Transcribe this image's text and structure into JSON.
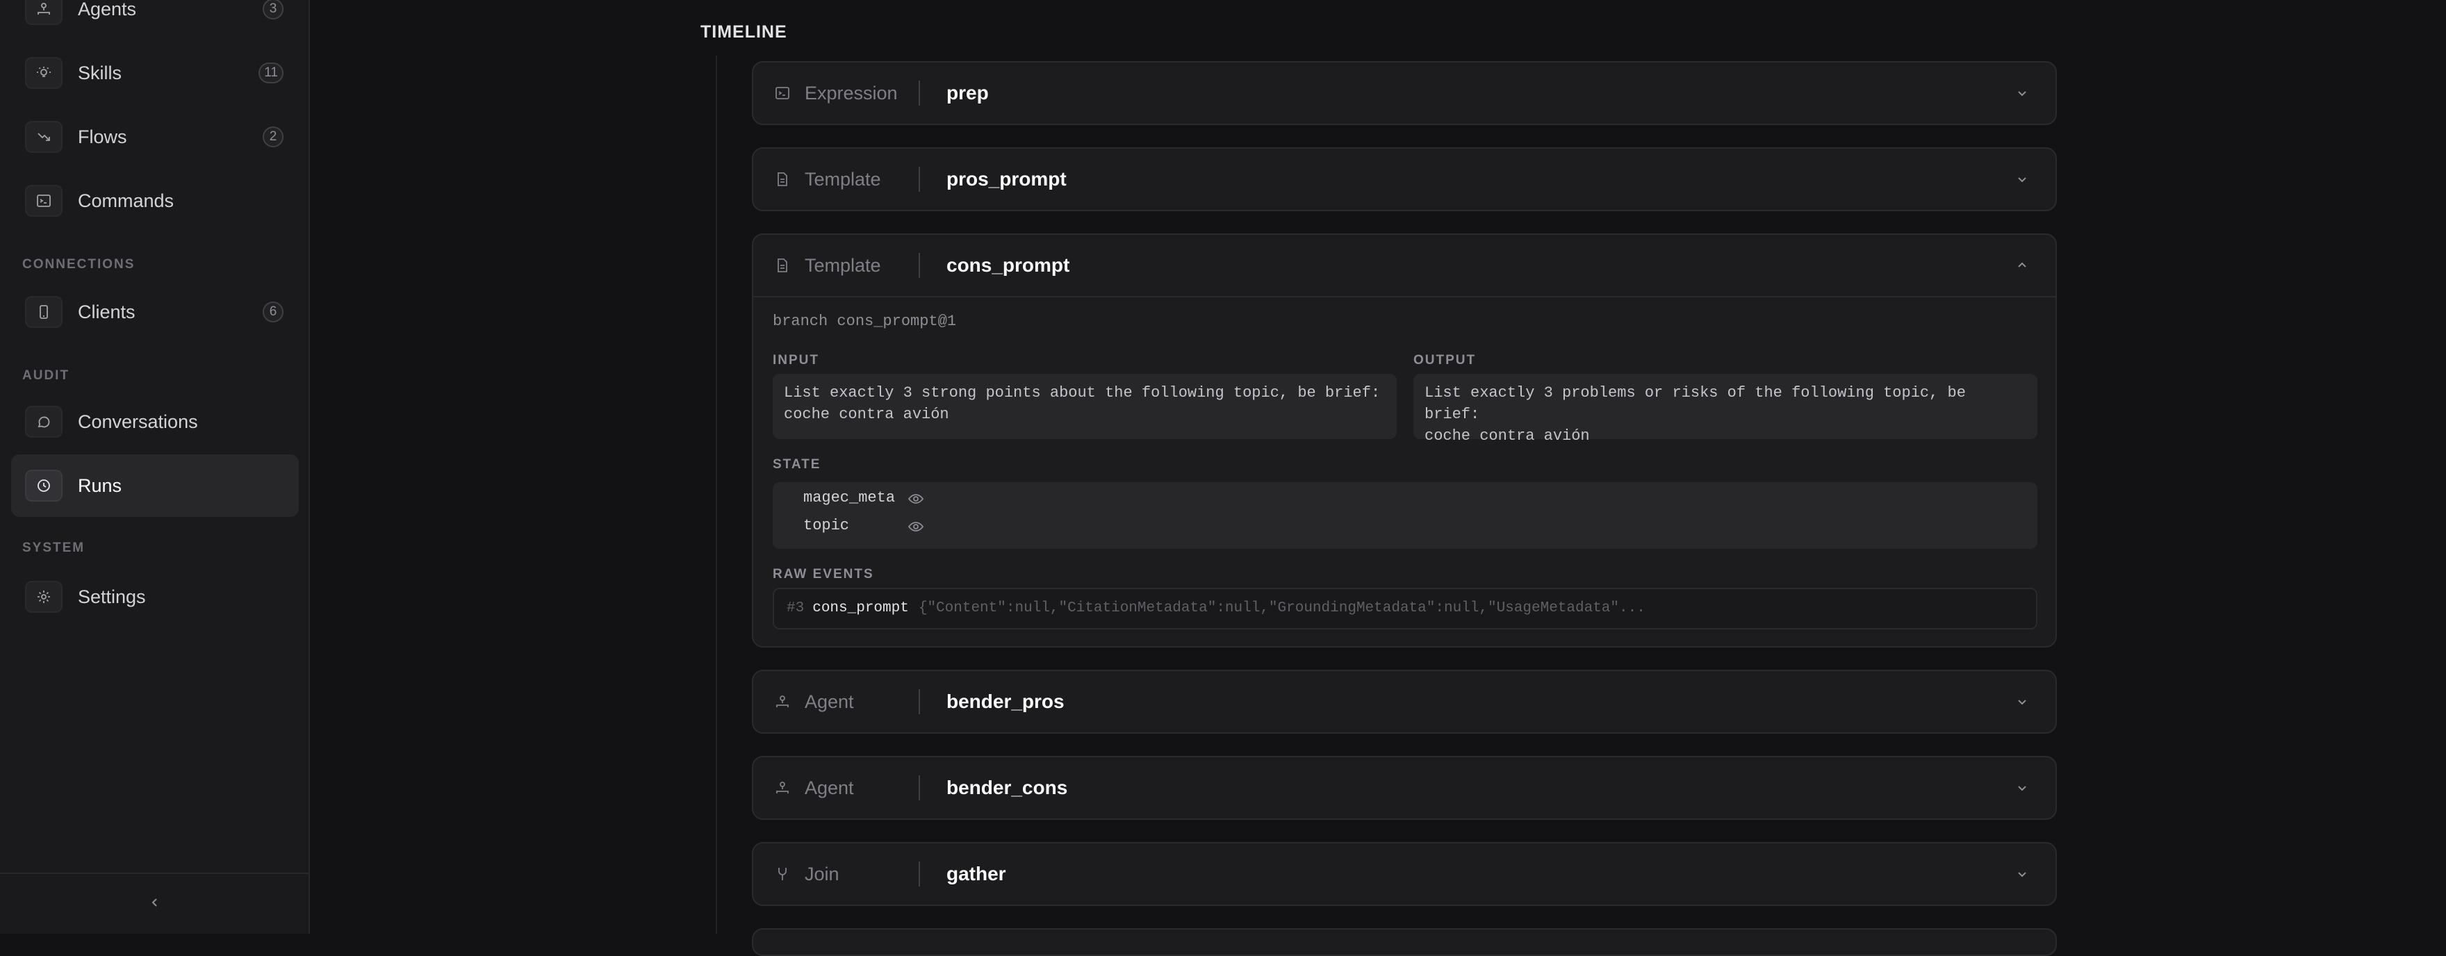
{
  "sidebar": {
    "items_top": [
      {
        "label": "Agents",
        "count": "3",
        "icon": "agents-icon"
      },
      {
        "label": "Skills",
        "count": "11",
        "icon": "lightbulb-icon"
      },
      {
        "label": "Flows",
        "count": "2",
        "icon": "flow-arrow-icon"
      },
      {
        "label": "Commands",
        "icon": "terminal-icon"
      }
    ],
    "sections": {
      "connections": "CONNECTIONS",
      "audit": "AUDIT",
      "system": "SYSTEM"
    },
    "connections_items": [
      {
        "label": "Clients",
        "count": "6",
        "icon": "device-icon"
      }
    ],
    "audit_items": [
      {
        "label": "Conversations",
        "icon": "chat-icon"
      },
      {
        "label": "Runs",
        "icon": "clock-icon",
        "active": true
      }
    ],
    "system_items": [
      {
        "label": "Settings",
        "icon": "gear-icon"
      }
    ],
    "collapse_label": "‹"
  },
  "timeline": {
    "heading": "TIMELINE",
    "steps": [
      {
        "type": "Expression",
        "name": "prep",
        "icon": "terminal-icon",
        "expanded": false
      },
      {
        "type": "Template",
        "name": "pros_prompt",
        "icon": "document-icon",
        "expanded": false
      },
      {
        "type": "Template",
        "name": "cons_prompt",
        "icon": "document-icon",
        "expanded": true,
        "branch": "branch cons_prompt@1",
        "input_label": "INPUT",
        "input_lines": [
          "List exactly 3 strong points about the following topic, be brief:",
          "coche contra avión"
        ],
        "output_label": "OUTPUT",
        "output_lines": [
          "List exactly 3 problems or risks of the following topic, be brief:",
          "coche contra avión"
        ],
        "state_label": "STATE",
        "state_keys": [
          "magec_meta",
          "topic"
        ],
        "raw_label": "RAW EVENTS",
        "raw_event": {
          "num": "#3",
          "name": "cons_prompt",
          "json": "{\"Content\":null,\"CitationMetadata\":null,\"GroundingMetadata\":null,\"UsageMetadata\"..."
        }
      },
      {
        "type": "Agent",
        "name": "bender_pros",
        "icon": "agents-icon",
        "expanded": false
      },
      {
        "type": "Agent",
        "name": "bender_cons",
        "icon": "agents-icon",
        "expanded": false
      },
      {
        "type": "Join",
        "name": "gather",
        "icon": "fork-icon",
        "expanded": false
      }
    ]
  },
  "colors": {
    "background": "#121214",
    "sidebar": "#1a1a1d",
    "card": "#1c1c1f",
    "active_item": "#27272a"
  }
}
